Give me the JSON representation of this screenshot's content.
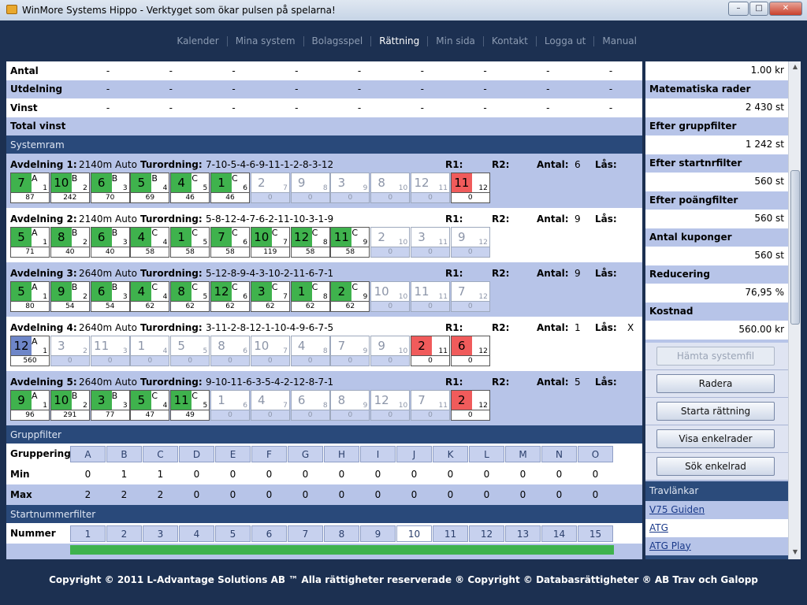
{
  "window": {
    "title": "WinMore Systems Hippo - Verktyget som ökar pulsen på spelarna!"
  },
  "nav": [
    {
      "label": "Kalender"
    },
    {
      "label": "Mina system"
    },
    {
      "label": "Bolagsspel"
    },
    {
      "label": "Rättning",
      "active": true
    },
    {
      "label": "Min sida"
    },
    {
      "label": "Kontakt"
    },
    {
      "label": "Logga ut"
    },
    {
      "label": "Manual"
    }
  ],
  "summary": [
    {
      "label": "Antal",
      "values": [
        "-",
        "-",
        "-",
        "-",
        "-",
        "-",
        "-",
        "-",
        "-"
      ]
    },
    {
      "label": "Utdelning",
      "values": [
        "-",
        "-",
        "-",
        "-",
        "-",
        "-",
        "-",
        "-",
        "-"
      ]
    },
    {
      "label": "Vinst",
      "values": [
        "-",
        "-",
        "-",
        "-",
        "-",
        "-",
        "-",
        "-",
        "-"
      ]
    },
    {
      "label": "Total vinst",
      "values": []
    }
  ],
  "systemram": {
    "title": "Systemram",
    "avdelningar": [
      {
        "label": "Avdelning 1:",
        "distance": "2140m Auto",
        "turordning_label": "Turordning:",
        "turordning": "7-10-5-4-6-9-11-1-2-8-3-12",
        "r1": "R1:",
        "r2": "R2:",
        "antal_label": "Antal:",
        "antal": "6",
        "las_label": "Lås:",
        "las": "",
        "cells": [
          {
            "n": "7",
            "g": "A",
            "p": "1",
            "v": "87",
            "s": "g"
          },
          {
            "n": "10",
            "g": "B",
            "p": "2",
            "v": "242",
            "s": "g"
          },
          {
            "n": "6",
            "g": "B",
            "p": "3",
            "v": "70",
            "s": "g"
          },
          {
            "n": "5",
            "g": "B",
            "p": "4",
            "v": "69",
            "s": "g"
          },
          {
            "n": "4",
            "g": "C",
            "p": "5",
            "v": "46",
            "s": "g"
          },
          {
            "n": "1",
            "g": "C",
            "p": "6",
            "v": "46",
            "s": "g"
          },
          {
            "n": "2",
            "g": "",
            "p": "7",
            "v": "0",
            "s": "u"
          },
          {
            "n": "9",
            "g": "",
            "p": "8",
            "v": "0",
            "s": "u"
          },
          {
            "n": "3",
            "g": "",
            "p": "9",
            "v": "0",
            "s": "u"
          },
          {
            "n": "8",
            "g": "",
            "p": "10",
            "v": "0",
            "s": "u"
          },
          {
            "n": "12",
            "g": "",
            "p": "11",
            "v": "0",
            "s": "u"
          },
          {
            "n": "11",
            "g": "",
            "p": "12",
            "v": "0",
            "s": "r"
          }
        ]
      },
      {
        "label": "Avdelning 2:",
        "distance": "2140m Auto",
        "turordning_label": "Turordning:",
        "turordning": "5-8-12-4-7-6-2-11-10-3-1-9",
        "r1": "R1:",
        "r2": "R2:",
        "antal_label": "Antal:",
        "antal": "9",
        "las_label": "Lås:",
        "las": "",
        "cells": [
          {
            "n": "5",
            "g": "A",
            "p": "1",
            "v": "71",
            "s": "g"
          },
          {
            "n": "8",
            "g": "B",
            "p": "2",
            "v": "40",
            "s": "g"
          },
          {
            "n": "6",
            "g": "B",
            "p": "3",
            "v": "40",
            "s": "g"
          },
          {
            "n": "4",
            "g": "C",
            "p": "4",
            "v": "58",
            "s": "g"
          },
          {
            "n": "1",
            "g": "C",
            "p": "5",
            "v": "58",
            "s": "g"
          },
          {
            "n": "7",
            "g": "C",
            "p": "6",
            "v": "58",
            "s": "g"
          },
          {
            "n": "10",
            "g": "C",
            "p": "7",
            "v": "119",
            "s": "g"
          },
          {
            "n": "12",
            "g": "C",
            "p": "8",
            "v": "58",
            "s": "g"
          },
          {
            "n": "11",
            "g": "C",
            "p": "9",
            "v": "58",
            "s": "g"
          },
          {
            "n": "2",
            "g": "",
            "p": "10",
            "v": "0",
            "s": "u"
          },
          {
            "n": "3",
            "g": "",
            "p": "11",
            "v": "0",
            "s": "u"
          },
          {
            "n": "9",
            "g": "",
            "p": "12",
            "v": "0",
            "s": "u"
          }
        ]
      },
      {
        "label": "Avdelning 3:",
        "distance": "2640m Auto",
        "turordning_label": "Turordning:",
        "turordning": "5-12-8-9-4-3-10-2-11-6-7-1",
        "r1": "R1:",
        "r2": "R2:",
        "antal_label": "Antal:",
        "antal": "9",
        "las_label": "Lås:",
        "las": "",
        "cells": [
          {
            "n": "5",
            "g": "A",
            "p": "1",
            "v": "80",
            "s": "g"
          },
          {
            "n": "9",
            "g": "B",
            "p": "2",
            "v": "54",
            "s": "g"
          },
          {
            "n": "6",
            "g": "B",
            "p": "3",
            "v": "54",
            "s": "g"
          },
          {
            "n": "4",
            "g": "C",
            "p": "4",
            "v": "62",
            "s": "g"
          },
          {
            "n": "8",
            "g": "C",
            "p": "5",
            "v": "62",
            "s": "g"
          },
          {
            "n": "12",
            "g": "C",
            "p": "6",
            "v": "62",
            "s": "g"
          },
          {
            "n": "3",
            "g": "C",
            "p": "7",
            "v": "62",
            "s": "g"
          },
          {
            "n": "1",
            "g": "C",
            "p": "8",
            "v": "62",
            "s": "g"
          },
          {
            "n": "2",
            "g": "C",
            "p": "9",
            "v": "62",
            "s": "g"
          },
          {
            "n": "10",
            "g": "",
            "p": "10",
            "v": "0",
            "s": "u"
          },
          {
            "n": "11",
            "g": "",
            "p": "11",
            "v": "0",
            "s": "u"
          },
          {
            "n": "7",
            "g": "",
            "p": "12",
            "v": "0",
            "s": "u"
          }
        ]
      },
      {
        "label": "Avdelning 4:",
        "distance": "2640m Auto",
        "turordning_label": "Turordning:",
        "turordning": "3-11-2-8-12-1-10-4-9-6-7-5",
        "r1": "R1:",
        "r2": "R2:",
        "antal_label": "Antal:",
        "antal": "1",
        "las_label": "Lås:",
        "las": "X",
        "cells": [
          {
            "n": "12",
            "g": "A",
            "p": "1",
            "v": "560",
            "s": "bl"
          },
          {
            "n": "3",
            "g": "",
            "p": "2",
            "v": "0",
            "s": "u"
          },
          {
            "n": "11",
            "g": "",
            "p": "3",
            "v": "0",
            "s": "u"
          },
          {
            "n": "1",
            "g": "",
            "p": "4",
            "v": "0",
            "s": "u"
          },
          {
            "n": "5",
            "g": "",
            "p": "5",
            "v": "0",
            "s": "u"
          },
          {
            "n": "8",
            "g": "",
            "p": "6",
            "v": "0",
            "s": "u"
          },
          {
            "n": "10",
            "g": "",
            "p": "7",
            "v": "0",
            "s": "u"
          },
          {
            "n": "4",
            "g": "",
            "p": "8",
            "v": "0",
            "s": "u"
          },
          {
            "n": "7",
            "g": "",
            "p": "9",
            "v": "0",
            "s": "u"
          },
          {
            "n": "9",
            "g": "",
            "p": "10",
            "v": "0",
            "s": "u"
          },
          {
            "n": "2",
            "g": "",
            "p": "11",
            "v": "0",
            "s": "r"
          },
          {
            "n": "6",
            "g": "",
            "p": "12",
            "v": "0",
            "s": "r"
          }
        ]
      },
      {
        "label": "Avdelning 5:",
        "distance": "2640m Auto",
        "turordning_label": "Turordning:",
        "turordning": "9-10-11-6-3-5-4-2-12-8-7-1",
        "r1": "R1:",
        "r2": "R2:",
        "antal_label": "Antal:",
        "antal": "5",
        "las_label": "Lås:",
        "las": "",
        "cells": [
          {
            "n": "9",
            "g": "A",
            "p": "1",
            "v": "96",
            "s": "g"
          },
          {
            "n": "10",
            "g": "B",
            "p": "2",
            "v": "291",
            "s": "g"
          },
          {
            "n": "3",
            "g": "B",
            "p": "3",
            "v": "77",
            "s": "g"
          },
          {
            "n": "5",
            "g": "C",
            "p": "4",
            "v": "47",
            "s": "g"
          },
          {
            "n": "11",
            "g": "C",
            "p": "5",
            "v": "49",
            "s": "g"
          },
          {
            "n": "1",
            "g": "",
            "p": "6",
            "v": "0",
            "s": "u"
          },
          {
            "n": "4",
            "g": "",
            "p": "7",
            "v": "0",
            "s": "u"
          },
          {
            "n": "6",
            "g": "",
            "p": "8",
            "v": "0",
            "s": "u"
          },
          {
            "n": "8",
            "g": "",
            "p": "9",
            "v": "0",
            "s": "u"
          },
          {
            "n": "12",
            "g": "",
            "p": "10",
            "v": "0",
            "s": "u"
          },
          {
            "n": "7",
            "g": "",
            "p": "11",
            "v": "0",
            "s": "u"
          },
          {
            "n": "2",
            "g": "",
            "p": "12",
            "v": "0",
            "s": "r"
          }
        ]
      }
    ]
  },
  "gruppfilter": {
    "title": "Gruppfilter",
    "header_label": "Gruppering",
    "columns": [
      "A",
      "B",
      "C",
      "D",
      "E",
      "F",
      "G",
      "H",
      "I",
      "J",
      "K",
      "L",
      "M",
      "N",
      "O"
    ],
    "min_label": "Min",
    "min": [
      "0",
      "1",
      "1",
      "0",
      "0",
      "0",
      "0",
      "0",
      "0",
      "0",
      "0",
      "0",
      "0",
      "0",
      "0"
    ],
    "max_label": "Max",
    "max": [
      "2",
      "2",
      "2",
      "0",
      "0",
      "0",
      "0",
      "0",
      "0",
      "0",
      "0",
      "0",
      "0",
      "0",
      "0"
    ]
  },
  "startnummerfilter": {
    "title": "Startnummerfilter",
    "header_label": "Nummer",
    "columns": [
      "1",
      "2",
      "3",
      "4",
      "5",
      "6",
      "7",
      "8",
      "9",
      "10",
      "11",
      "12",
      "13",
      "14",
      "15"
    ]
  },
  "sidebar": {
    "items": [
      {
        "label": "",
        "value": "1.00 kr"
      },
      {
        "label": "Matematiska rader",
        "value": "2 430 st"
      },
      {
        "label": "Efter gruppfilter",
        "value": "1 242 st"
      },
      {
        "label": "Efter startnrfilter",
        "value": "560 st"
      },
      {
        "label": "Efter poängfilter",
        "value": "560 st"
      },
      {
        "label": "Antal kuponger",
        "value": "560 st"
      },
      {
        "label": "Reducering",
        "value": "76,95 %"
      },
      {
        "label": "Kostnad",
        "value": "560.00 kr"
      }
    ],
    "buttons": [
      {
        "label": "Hämta systemfil",
        "disabled": true
      },
      {
        "label": "Radera"
      },
      {
        "label": "Starta rättning"
      },
      {
        "label": "Visa enkelrader"
      },
      {
        "label": "Sök enkelrad"
      }
    ],
    "links_title": "Travlänkar",
    "links": [
      "V75 Guiden",
      "ATG",
      "ATG Play"
    ]
  },
  "footer": "Copyright © 2011 L-Advantage Solutions AB ™ Alla rättigheter reserverade ® Copyright © Databasrättigheter ® AB Trav och Galopp"
}
